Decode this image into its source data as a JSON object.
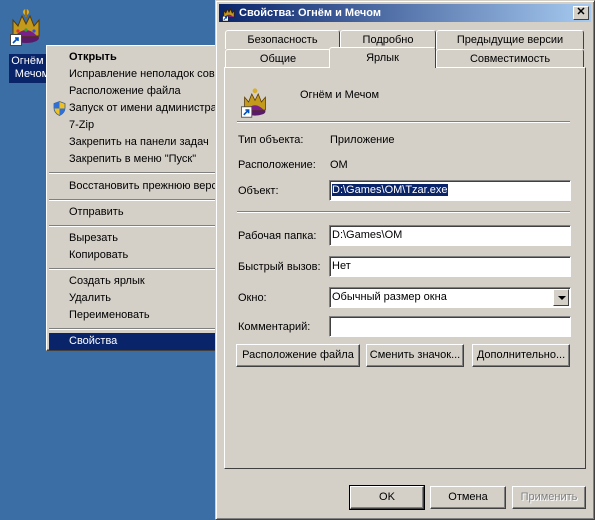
{
  "desktop": {
    "icon_label_line1": "Огнём и",
    "icon_label_line2": "Мечом"
  },
  "context_menu": {
    "items": [
      {
        "label": "Открыть",
        "bold": true
      },
      {
        "label": "Исправление неполадок совместимости"
      },
      {
        "label": "Расположение файла"
      },
      {
        "label": "Запуск от имени администратора",
        "icon": "shield-icon"
      },
      {
        "label": "7-Zip"
      },
      {
        "label": "Закрепить на панели задач"
      },
      {
        "label": "Закрепить в меню \"Пуск\""
      },
      {
        "label": "Восстановить прежнюю версию"
      },
      {
        "label": "Отправить"
      },
      {
        "label": "Вырезать"
      },
      {
        "label": "Копировать"
      },
      {
        "label": "Создать ярлык"
      },
      {
        "label": "Удалить"
      },
      {
        "label": "Переименовать"
      },
      {
        "label": "Свойства",
        "selected": true
      }
    ]
  },
  "dialog": {
    "title": "Свойства: Огнём и Мечом",
    "tabs_row1": [
      "Безопасность",
      "Подробно",
      "Предыдущие версии"
    ],
    "tabs_row2": [
      "Общие",
      "Ярлык",
      "Совместимость"
    ],
    "active_tab": "Ярлык",
    "shortcut_name": "Огнём и Мечом",
    "object_type_label": "Тип объекта:",
    "object_type_value": "Приложение",
    "location_label": "Расположение:",
    "location_value": "OM",
    "target_label": "Объект:",
    "target_value": "D:\\Games\\OM\\Tzar.exe",
    "workdir_label": "Рабочая папка:",
    "workdir_value": "D:\\Games\\OM",
    "hotkey_label": "Быстрый вызов:",
    "hotkey_value": "Нет",
    "window_label": "Окно:",
    "window_value": "Обычный размер окна",
    "comment_label": "Комментарий:",
    "comment_value": "",
    "btn_file_location": "Расположение файла",
    "btn_change_icon": "Сменить значок...",
    "btn_advanced": "Дополнительно...",
    "btn_ok": "OK",
    "btn_cancel": "Отмена",
    "btn_apply": "Применить"
  },
  "colors": {
    "desktop": "#3a6ea5",
    "titlebar_start": "#0a246a",
    "titlebar_end": "#a6caf0",
    "face": "#d4d0c8",
    "selection": "#0a246a"
  }
}
